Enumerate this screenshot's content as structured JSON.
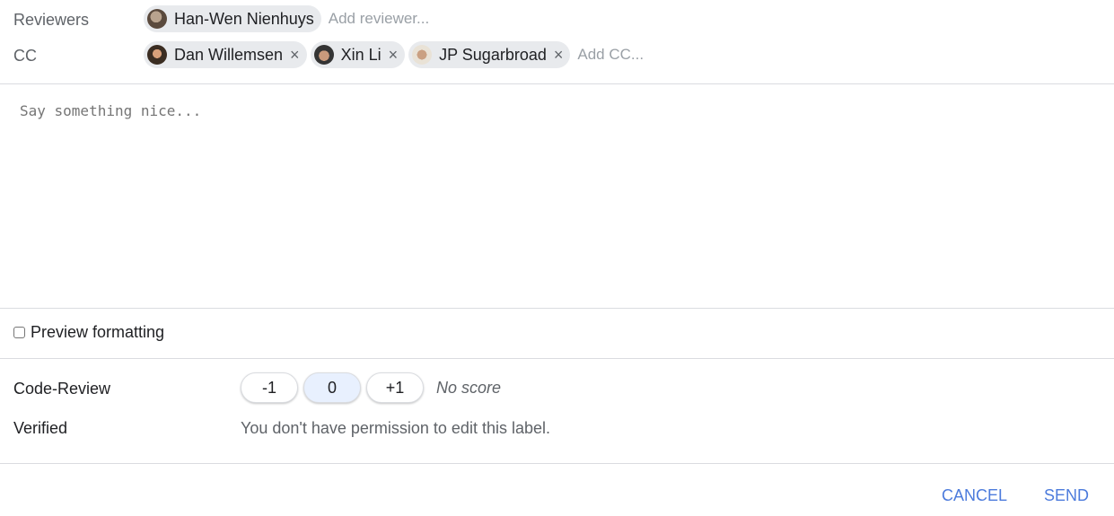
{
  "reviewers": {
    "label": "Reviewers",
    "chips": [
      {
        "name": "Han-Wen Nienhuys",
        "avatar": "person-avatar"
      }
    ],
    "add_placeholder": "Add reviewer..."
  },
  "cc": {
    "label": "CC",
    "chips": [
      {
        "name": "Dan Willemsen",
        "remove_icon": "×"
      },
      {
        "name": "Xin Li",
        "remove_icon": "×"
      },
      {
        "name": "JP Sugarbroad",
        "remove_icon": "×"
      }
    ],
    "add_placeholder": "Add CC..."
  },
  "message": {
    "placeholder": "Say something nice..."
  },
  "preview": {
    "label": "Preview formatting",
    "checked": false
  },
  "labels": {
    "code_review": {
      "name": "Code-Review",
      "options": [
        "-1",
        "0",
        "+1"
      ],
      "selected": "0",
      "status": "No score"
    },
    "verified": {
      "name": "Verified",
      "message": "You don't have permission to edit this label."
    }
  },
  "actions": {
    "cancel": "CANCEL",
    "send": "SEND"
  },
  "colors": {
    "accent": "#4c7bdc",
    "chip_bg": "#e8eaed",
    "selected_vote_bg": "#e8f0fe",
    "divider": "#dadce0"
  }
}
